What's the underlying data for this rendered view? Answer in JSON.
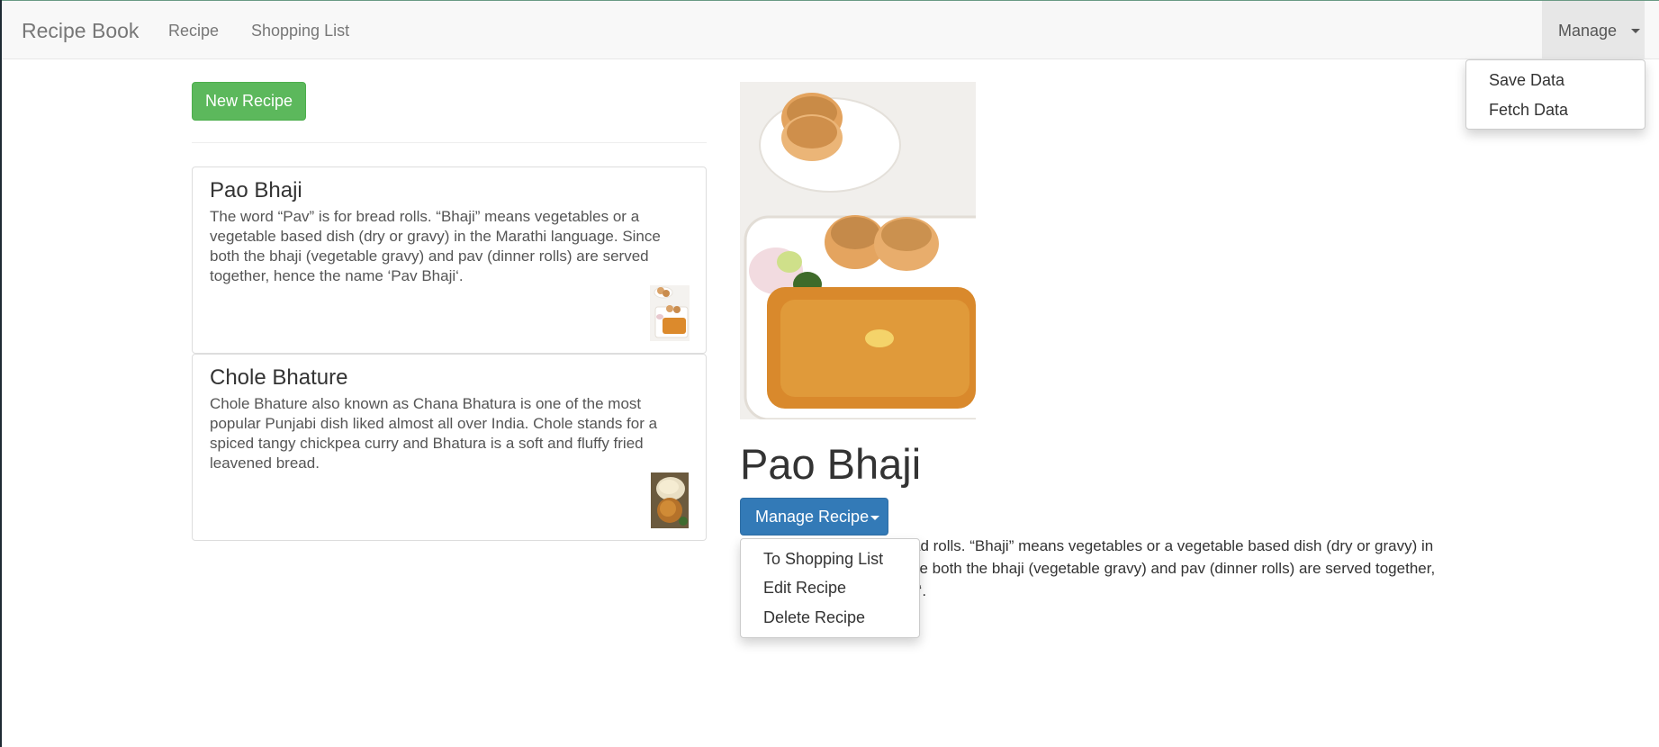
{
  "navbar": {
    "brand": "Recipe Book",
    "links": [
      "Recipe",
      "Shopping List"
    ],
    "manage_label": "Manage"
  },
  "manage_menu": {
    "items": [
      "Save Data",
      "Fetch Data"
    ]
  },
  "list": {
    "new_recipe_label": "New Recipe",
    "recipes": [
      {
        "name": "Pao Bhaji",
        "description": "The word “Pav” is for bread rolls. “Bhaji” means vegetables or a vegetable based dish (dry or gravy) in the Marathi language. Since both the bhaji (vegetable gravy) and pav (dinner rolls) are served together, hence the name ‘Pav Bhaji‘."
      },
      {
        "name": "Chole Bhature",
        "description": "Chole Bhature also known as Chana Bhatura is one of the most popular Punjabi dish liked almost all over India. Chole stands for a spiced tangy chickpea curry and Bhatura is a soft and fluffy fried leavened bread."
      }
    ]
  },
  "detail": {
    "title": "Pao Bhaji",
    "manage_recipe_label": "Manage Recipe",
    "description_visible_lines": [
      "ad rolls. “Bhaji” means vegetables or a vegetable based dish (dry or gravy) in",
      "ce both the bhaji (vegetable gravy) and pav (dinner rolls) are served together,",
      "ji‘."
    ]
  },
  "recipe_menu": {
    "items": [
      "To Shopping List",
      "Edit Recipe",
      "Delete Recipe"
    ]
  },
  "colors": {
    "success": "#5cb85c",
    "primary": "#337ab7",
    "navbar_bg": "#f8f8f8"
  }
}
